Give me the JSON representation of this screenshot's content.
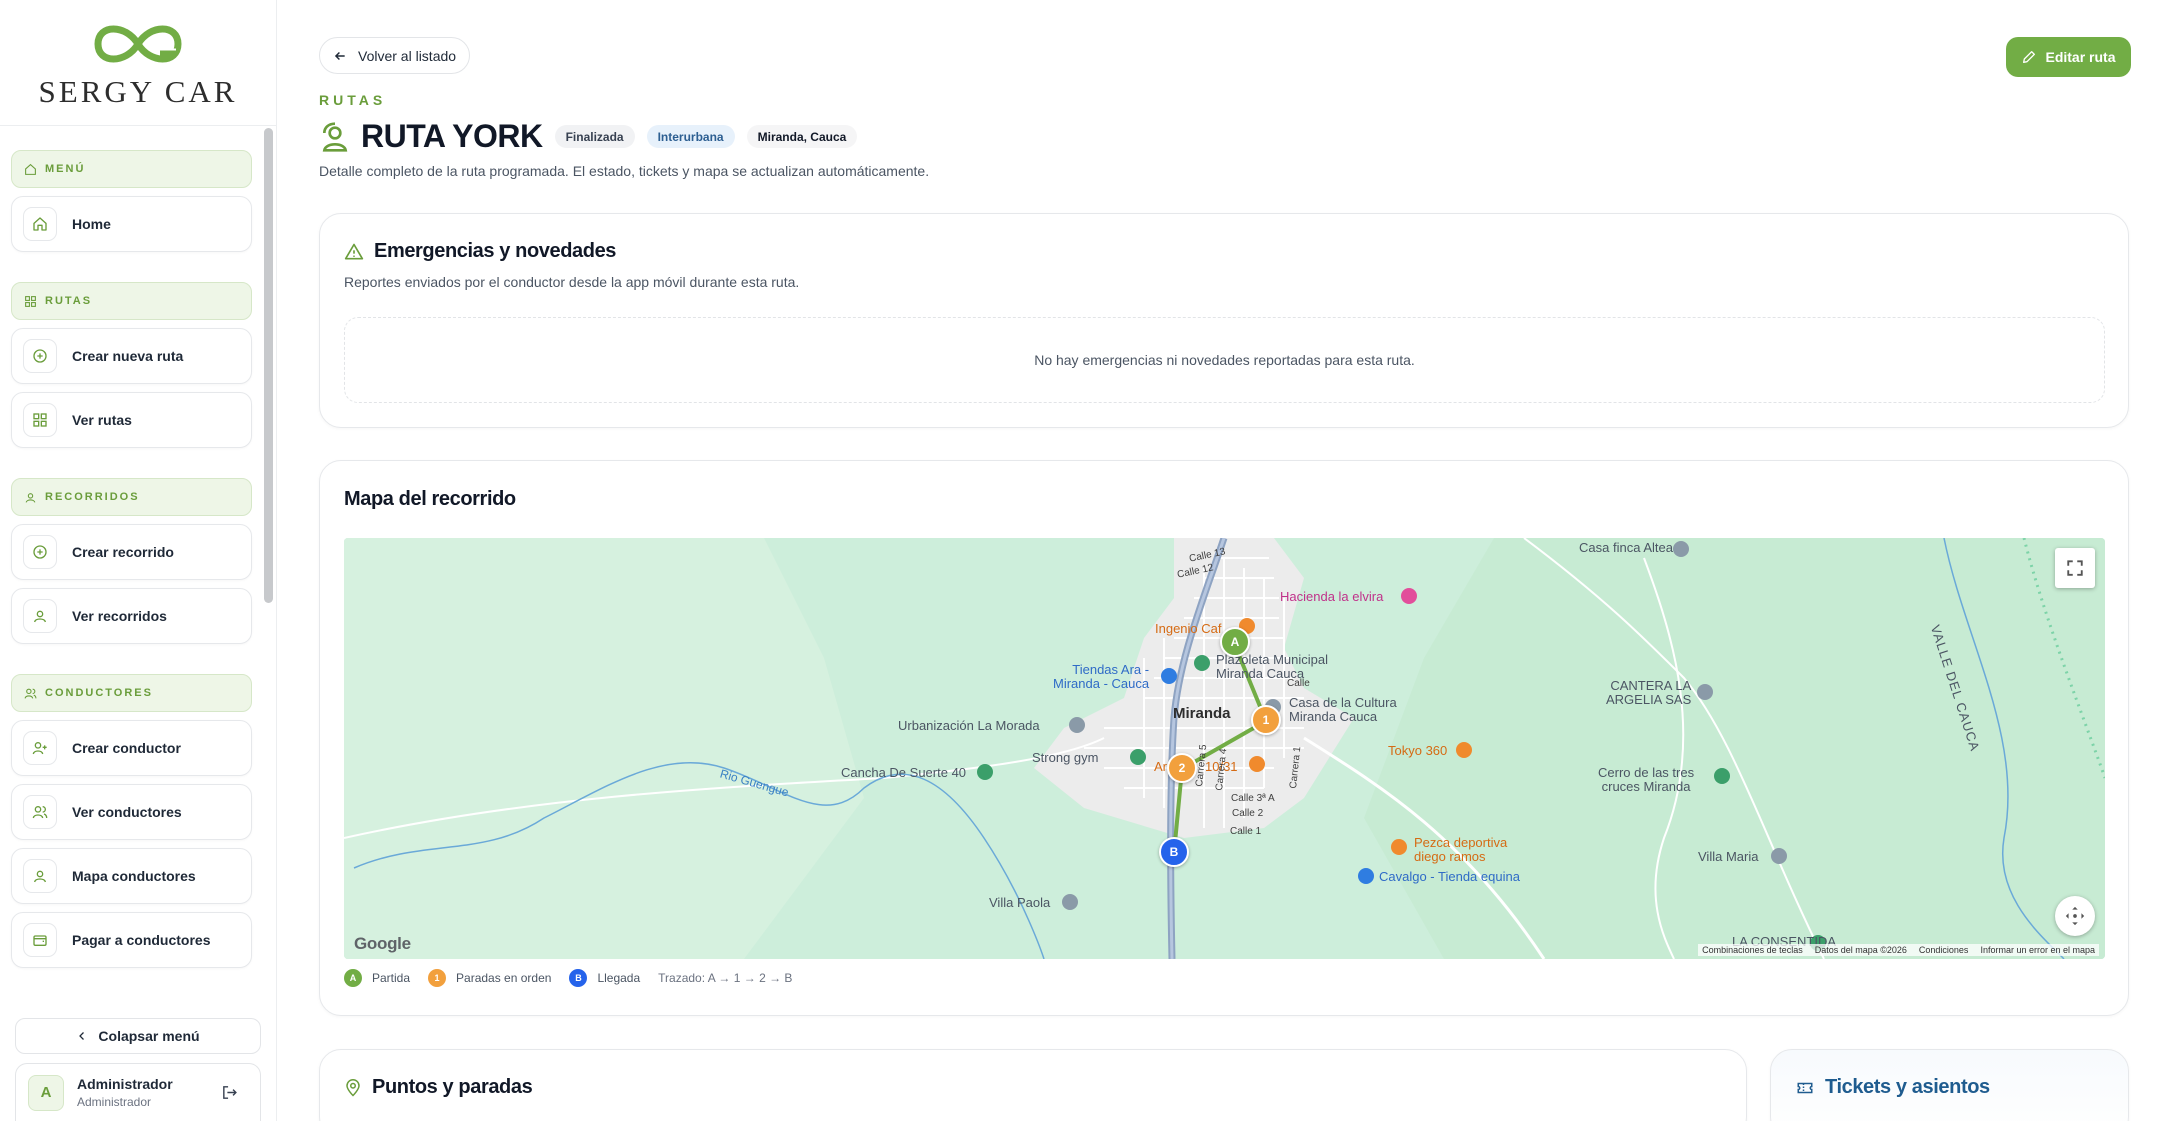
{
  "brand": {
    "name": "SERGY CAR",
    "logo_color": "#72ad45"
  },
  "sidebar": {
    "sections": [
      {
        "title": "MENÚ",
        "items": [
          {
            "label": "Home"
          }
        ]
      },
      {
        "title": "RUTAS",
        "items": [
          {
            "label": "Crear nueva ruta"
          },
          {
            "label": "Ver rutas"
          }
        ]
      },
      {
        "title": "RECORRIDOS",
        "items": [
          {
            "label": "Crear recorrido"
          },
          {
            "label": "Ver recorridos"
          }
        ]
      },
      {
        "title": "CONDUCTORES",
        "items": [
          {
            "label": "Crear conductor"
          },
          {
            "label": "Ver conductores"
          },
          {
            "label": "Mapa conductores"
          },
          {
            "label": "Pagar a conductores"
          }
        ]
      }
    ],
    "collapse_label": "Colapsar menú",
    "user": {
      "initial": "A",
      "name": "Administrador",
      "role": "Administrador"
    }
  },
  "header": {
    "back_label": "Volver al listado",
    "edit_label": "Editar ruta",
    "eyebrow": "RUTAS",
    "title": "RUTA YORK",
    "badges": {
      "status": "Finalizada",
      "type": "Interurbana",
      "location": "Miranda, Cauca"
    },
    "subtitle": "Detalle completo de la ruta programada. El estado, tickets y mapa se actualizan automáticamente."
  },
  "emergencies": {
    "title": "Emergencias y novedades",
    "description": "Reportes enviados por el conductor desde la app móvil durante esta ruta.",
    "empty": "No hay emergencias ni novedades reportadas para esta ruta."
  },
  "map_card": {
    "title": "Mapa del recorrido",
    "labels": {
      "casa_finca": "Casa finca Altea",
      "hacienda": "Hacienda la elvira",
      "ingenio": "Ingenio Caf",
      "plazoleta": "Plazoleta Municipal\nMiranda Cauca",
      "tiendas": "Tiendas Ara -\nMiranda - Cauca",
      "urbanizacion": "Urbanización La Morada",
      "miranda": "Miranda",
      "casa_cultura": "Casa de la Cultura\nMiranda Cauca",
      "strong": "Strong gym",
      "cancha": "Cancha De Suerte 40",
      "tokyo": "Tokyo 360",
      "cerro": "Cerro de las tres\ncruces Miranda",
      "cantera": "CANTERA LA\nARGELIA SAS",
      "valle": "VALLE DEL CAUCA",
      "pezca": "Pezca deportiva\ndiego ramos",
      "cavalgo": "Cavalgo - Tienda equina",
      "villa_maria": "Villa Maria",
      "villa_paola": "Villa Paola",
      "consentida": "LA CONSENTIDA",
      "rio": "Rio Guengue",
      "ar": "Ar",
      "ten": "10/31",
      "calle_12": "Calle 12",
      "calle_13": "Calle 13",
      "calle_2": "Calle 2",
      "calle_1": "Calle 1",
      "calle_3a": "Calle 3ª A",
      "carrera_5": "Carrera 5",
      "carrera_4": "Carrera 4",
      "carrera_1": "Carrera 1",
      "calle_short": "Calle"
    },
    "markers": {
      "start": "A",
      "stop1": "1",
      "stop2": "2",
      "end": "B"
    },
    "google": "Google",
    "attribution": [
      "Combinaciones de teclas",
      "Datos del mapa ©2026",
      "Condiciones",
      "Informar un error en el mapa"
    ],
    "legend": {
      "start": "Partida",
      "stops": "Paradas en orden",
      "end": "Llegada",
      "trace": "Trazado: A → 1 → 2 → B"
    }
  },
  "points": {
    "title": "Puntos y paradas"
  },
  "tickets": {
    "title": "Tickets y asientos"
  },
  "colors": {
    "accent": "#72ad45",
    "start": "#72ad45",
    "stop": "#f2a03d",
    "end": "#2563eb"
  }
}
